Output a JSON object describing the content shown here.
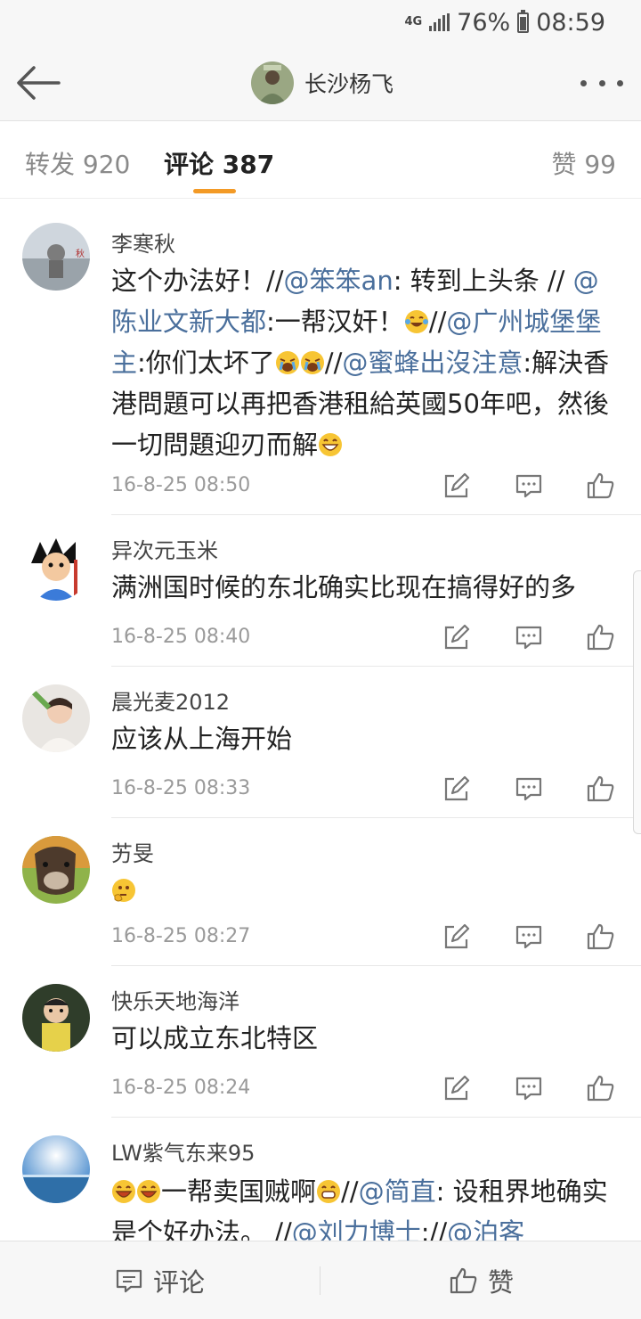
{
  "status_bar": {
    "network": "4G",
    "battery": "76%",
    "time": "08:59"
  },
  "header": {
    "title": "长沙杨飞"
  },
  "tabs": [
    {
      "label": "转发 920"
    },
    {
      "label": "评论 387"
    },
    {
      "label": "赞 99"
    }
  ],
  "comments": [
    {
      "user": "李寒秋",
      "c1": "这个办法好！//",
      "m1": "@笨笨an",
      "c2": ": 转到上头条 //",
      "m2": "@陈业文新大都",
      "c3": ":一帮汉奸！",
      "c4": "//",
      "m3": "@广州城堡堡主",
      "c5": ":你们太坏了",
      "c6": "//",
      "m4": "@蜜蜂出沒注意",
      "c7": ":解決香港問題可以再把香港租給英國50年吧，然後一切問題迎刃而解",
      "time": "16-8-25 08:50"
    },
    {
      "user": "异次元玉米",
      "text": "满洲国时候的东北确实比现在搞得好的多",
      "time": "16-8-25 08:40"
    },
    {
      "user": "晨光麦2012",
      "text": "应该从上海开始",
      "time": "16-8-25 08:33"
    },
    {
      "user": "艻旻",
      "time": "16-8-25 08:27"
    },
    {
      "user": "快乐天地海洋",
      "text": "可以成立东北特区",
      "time": "16-8-25 08:24"
    },
    {
      "user": "LW紫气东来95",
      "c1": "一帮卖国贼啊",
      "c2": "//",
      "m1": "@简直",
      "c3": ": 设租界地确实是个好办法。 //",
      "m2": "@刘力博士",
      "c4": "://",
      "m3": "@泊客"
    }
  ],
  "bottom_bar": {
    "comment_label": "评论",
    "like_label": "赞"
  },
  "colors": {
    "accent": "#f39a26",
    "mention": "#4a6f9c"
  }
}
